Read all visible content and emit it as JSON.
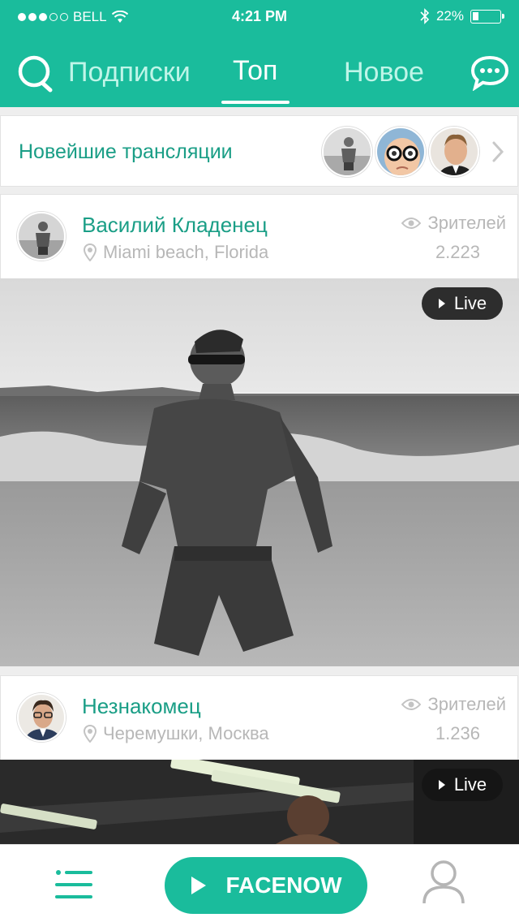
{
  "status_bar": {
    "carrier": "BELL",
    "time": "4:21 PM",
    "battery": "22%",
    "battery_level": 0.22
  },
  "tabs": [
    {
      "label": "Подписки",
      "active": false
    },
    {
      "label": "Топ",
      "active": true
    },
    {
      "label": "Новое",
      "active": false
    }
  ],
  "newest": {
    "label": "Новейшие трансляции"
  },
  "cards": [
    {
      "name": "Василий Кладенец",
      "location": "Miami beach, Florida",
      "viewers_label": "Зрителей",
      "viewers_count": "2.223",
      "live_label": "Live"
    },
    {
      "name": "Незнакомец",
      "location": "Черемушки, Москва",
      "viewers_label": "Зрителей",
      "viewers_count": "1.236",
      "live_label": "Live"
    }
  ],
  "bottom_bar": {
    "main_button": "FACENOW"
  },
  "colors": {
    "accent": "#1abc9c",
    "accent_text": "#1a9e86",
    "muted_text": "#b7b7b7"
  }
}
